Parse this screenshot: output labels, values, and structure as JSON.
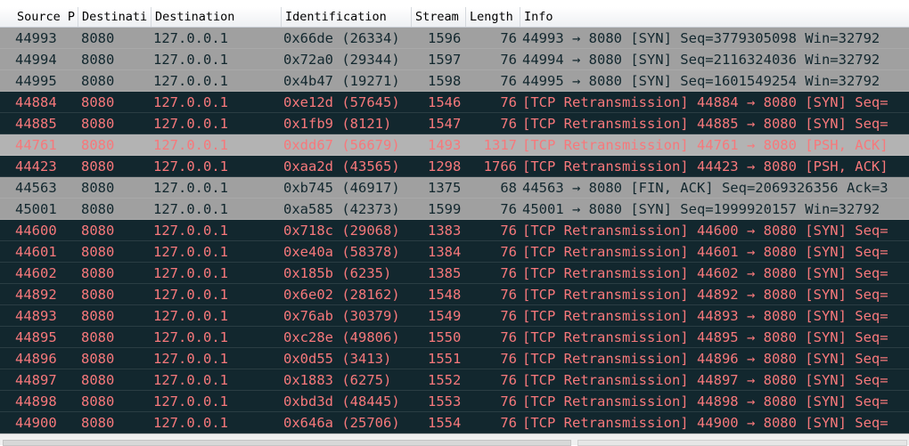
{
  "columns": {
    "source_port": "Source P",
    "dest_port": "Destinati",
    "destination": "Destination",
    "identification": "Identification",
    "stream": "Stream",
    "length": "Length",
    "info": "Info"
  },
  "rows": [
    {
      "src": "44993",
      "dst": "8080",
      "dip": "127.0.0.1",
      "id": "0x66de (26334)",
      "stream": "1596",
      "len": "76",
      "info": "44993 → 8080 [SYN] Seq=3779305098 Win=32792",
      "kind": "syn"
    },
    {
      "src": "44994",
      "dst": "8080",
      "dip": "127.0.0.1",
      "id": "0x72a0 (29344)",
      "stream": "1597",
      "len": "76",
      "info": "44994 → 8080 [SYN] Seq=2116324036 Win=32792",
      "kind": "syn"
    },
    {
      "src": "44995",
      "dst": "8080",
      "dip": "127.0.0.1",
      "id": "0x4b47 (19271)",
      "stream": "1598",
      "len": "76",
      "info": "44995 → 8080 [SYN] Seq=1601549254 Win=32792",
      "kind": "syn"
    },
    {
      "src": "44884",
      "dst": "8080",
      "dip": "127.0.0.1",
      "id": "0xe12d (57645)",
      "stream": "1546",
      "len": "76",
      "info": "[TCP Retransmission] 44884 → 8080 [SYN] Seq=",
      "kind": "retx"
    },
    {
      "src": "44885",
      "dst": "8080",
      "dip": "127.0.0.1",
      "id": "0x1fb9 (8121)",
      "stream": "1547",
      "len": "76",
      "info": "[TCP Retransmission] 44885 → 8080 [SYN] Seq=",
      "kind": "retx"
    },
    {
      "src": "44761",
      "dst": "8080",
      "dip": "127.0.0.1",
      "id": "0xdd67 (56679)",
      "stream": "1493",
      "len": "1317",
      "info": "[TCP Retransmission] 44761 → 8080 [PSH, ACK]",
      "kind": "sel"
    },
    {
      "src": "44423",
      "dst": "8080",
      "dip": "127.0.0.1",
      "id": "0xaa2d (43565)",
      "stream": "1298",
      "len": "1766",
      "info": "[TCP Retransmission] 44423 → 8080 [PSH, ACK]",
      "kind": "retx"
    },
    {
      "src": "44563",
      "dst": "8080",
      "dip": "127.0.0.1",
      "id": "0xb745 (46917)",
      "stream": "1375",
      "len": "68",
      "info": "44563 → 8080 [FIN, ACK] Seq=2069326356 Ack=3",
      "kind": "syn"
    },
    {
      "src": "45001",
      "dst": "8080",
      "dip": "127.0.0.1",
      "id": "0xa585 (42373)",
      "stream": "1599",
      "len": "76",
      "info": "45001 → 8080 [SYN] Seq=1999920157 Win=32792",
      "kind": "syn"
    },
    {
      "src": "44600",
      "dst": "8080",
      "dip": "127.0.0.1",
      "id": "0x718c (29068)",
      "stream": "1383",
      "len": "76",
      "info": "[TCP Retransmission] 44600 → 8080 [SYN] Seq=",
      "kind": "retx"
    },
    {
      "src": "44601",
      "dst": "8080",
      "dip": "127.0.0.1",
      "id": "0xe40a (58378)",
      "stream": "1384",
      "len": "76",
      "info": "[TCP Retransmission] 44601 → 8080 [SYN] Seq=",
      "kind": "retx"
    },
    {
      "src": "44602",
      "dst": "8080",
      "dip": "127.0.0.1",
      "id": "0x185b (6235)",
      "stream": "1385",
      "len": "76",
      "info": "[TCP Retransmission] 44602 → 8080 [SYN] Seq=",
      "kind": "retx"
    },
    {
      "src": "44892",
      "dst": "8080",
      "dip": "127.0.0.1",
      "id": "0x6e02 (28162)",
      "stream": "1548",
      "len": "76",
      "info": "[TCP Retransmission] 44892 → 8080 [SYN] Seq=",
      "kind": "retx"
    },
    {
      "src": "44893",
      "dst": "8080",
      "dip": "127.0.0.1",
      "id": "0x76ab (30379)",
      "stream": "1549",
      "len": "76",
      "info": "[TCP Retransmission] 44893 → 8080 [SYN] Seq=",
      "kind": "retx"
    },
    {
      "src": "44895",
      "dst": "8080",
      "dip": "127.0.0.1",
      "id": "0xc28e (49806)",
      "stream": "1550",
      "len": "76",
      "info": "[TCP Retransmission] 44895 → 8080 [SYN] Seq=",
      "kind": "retx"
    },
    {
      "src": "44896",
      "dst": "8080",
      "dip": "127.0.0.1",
      "id": "0x0d55 (3413)",
      "stream": "1551",
      "len": "76",
      "info": "[TCP Retransmission] 44896 → 8080 [SYN] Seq=",
      "kind": "retx"
    },
    {
      "src": "44897",
      "dst": "8080",
      "dip": "127.0.0.1",
      "id": "0x1883 (6275)",
      "stream": "1552",
      "len": "76",
      "info": "[TCP Retransmission] 44897 → 8080 [SYN] Seq=",
      "kind": "retx"
    },
    {
      "src": "44898",
      "dst": "8080",
      "dip": "127.0.0.1",
      "id": "0xbd3d (48445)",
      "stream": "1553",
      "len": "76",
      "info": "[TCP Retransmission] 44898 → 8080 [SYN] Seq=",
      "kind": "retx"
    },
    {
      "src": "44900",
      "dst": "8080",
      "dip": "127.0.0.1",
      "id": "0x646a (25706)",
      "stream": "1554",
      "len": "76",
      "info": "[TCP Retransmission] 44900 → 8080 [SYN] Seq=",
      "kind": "retx"
    }
  ],
  "colors": {
    "syn_bg": "#a0a0a0",
    "syn_fg": "#12272e",
    "retx_bg": "#12272e",
    "retx_fg": "#f7787b",
    "selected_bg": "#b3b3b3"
  }
}
